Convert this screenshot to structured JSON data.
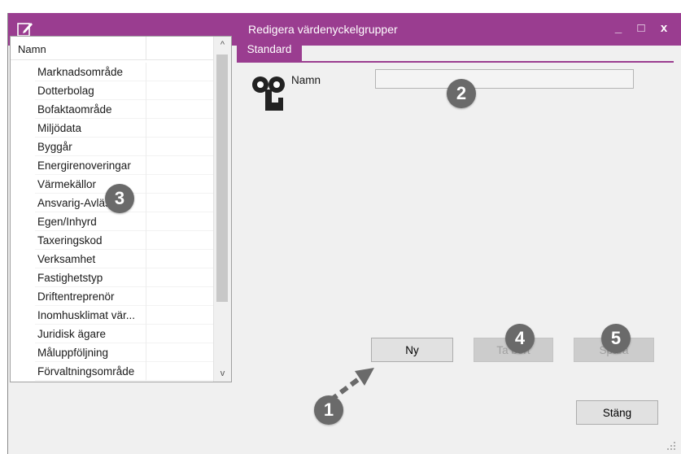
{
  "window": {
    "title": "Redigera värdenyckelgrupper",
    "controls": {
      "minimize": "_",
      "maximize": "□",
      "close": "x"
    }
  },
  "list": {
    "header": "Namn",
    "items": [
      "Marknadsområde",
      "Dotterbolag",
      "Bofaktaområde",
      "Miljödata",
      "Byggår",
      "Energirenoveringar",
      "Värmekällor",
      "Ansvarig-Avläsare",
      "Egen/Inhyrd",
      "Taxeringskod",
      "Verksamhet",
      "Fastighetstyp",
      "Driftentreprenör",
      "Inomhusklimat vär...",
      "Juridisk ägare",
      "Måluppföljning",
      "Förvaltningsområde"
    ],
    "scroll_up": "^",
    "scroll_down": "v"
  },
  "tabs": {
    "standard": "Standard"
  },
  "form": {
    "name_label": "Namn",
    "name_value": ""
  },
  "buttons": {
    "new": "Ny",
    "delete": "Ta bort",
    "save": "Spara",
    "close": "Stäng"
  },
  "callouts": {
    "c1": "1",
    "c2": "2",
    "c3": "3",
    "c4": "4",
    "c5": "5"
  },
  "colors": {
    "accent": "#9a3d90",
    "callout": "#6a6a6a"
  }
}
